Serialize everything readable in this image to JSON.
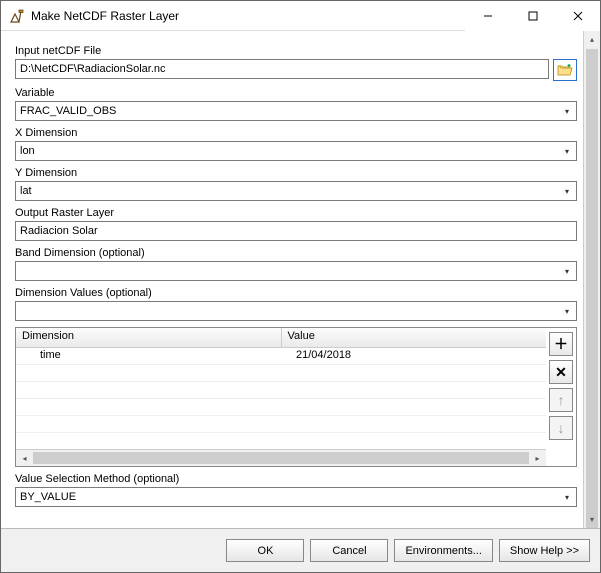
{
  "window": {
    "title": "Make NetCDF Raster Layer"
  },
  "fields": {
    "input_file": {
      "label": "Input netCDF File",
      "value": "D:\\NetCDF\\RadiacionSolar.nc"
    },
    "variable": {
      "label": "Variable",
      "value": "FRAC_VALID_OBS"
    },
    "x_dimension": {
      "label": "X Dimension",
      "value": "lon"
    },
    "y_dimension": {
      "label": "Y Dimension",
      "value": "lat"
    },
    "output_layer": {
      "label": "Output Raster Layer",
      "value": "Radiacion Solar"
    },
    "band_dimension": {
      "label": "Band Dimension (optional)",
      "value": ""
    },
    "dimension_values": {
      "label": "Dimension Values (optional)",
      "value": ""
    },
    "value_selection": {
      "label": "Value Selection Method (optional)",
      "value": "BY_VALUE"
    }
  },
  "table": {
    "headers": {
      "dimension": "Dimension",
      "value": "Value"
    },
    "rows": [
      {
        "dimension": "time",
        "value": "21/04/2018"
      }
    ]
  },
  "buttons": {
    "ok": "OK",
    "cancel": "Cancel",
    "environments": "Environments...",
    "show_help": "Show Help >>"
  }
}
